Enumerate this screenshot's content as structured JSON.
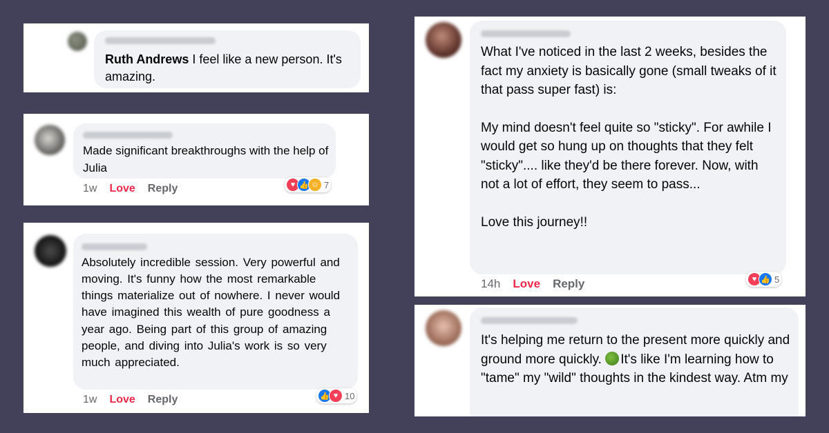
{
  "comments": [
    {
      "mention": "Ruth Andrews",
      "text": " I feel like a new person. It's amazing."
    },
    {
      "text": "Made significant breakthroughs with the help of Julia",
      "time": "1w",
      "love_label": "Love",
      "reply_label": "Reply",
      "reaction_count": "7"
    },
    {
      "text": "Absolutely incredible session. Very powerful and moving. It's funny how the most remarkable things materialize out of nowhere. I never would have imagined this wealth of pure goodness a year ago. Being part of this group of amazing people, and diving into Julia's work is so very much appreciated.",
      "time": "1w",
      "love_label": "Love",
      "reply_label": "Reply",
      "reaction_count": "10"
    },
    {
      "para1": "What I've noticed in the last 2 weeks, besides the fact my anxiety is basically gone (small tweaks of it that pass super fast) is:",
      "para2": "My mind doesn't feel quite so \"sticky\". For awhile I would get so hung up on thoughts that they felt \"sticky\".... like they'd be there forever. Now, with not a lot of effort, they seem to pass...",
      "para3": "Love this journey!!",
      "time": "14h",
      "love_label": "Love",
      "reply_label": "Reply",
      "reaction_count": "5"
    },
    {
      "text_a": "It's helping me return to the present more quickly and ground more quickly. ",
      "text_b": "It's like I'm learning how to \"tame\" my \"wild\" thoughts in the kindest way. Atm my"
    }
  ],
  "icons": {
    "heart": "heart-icon",
    "like": "thumbs-up-icon",
    "care": "care-icon",
    "tree": "tree-emoji"
  },
  "colors": {
    "background": "#43405a",
    "love": "#f0284a",
    "like": "#1877f2"
  }
}
